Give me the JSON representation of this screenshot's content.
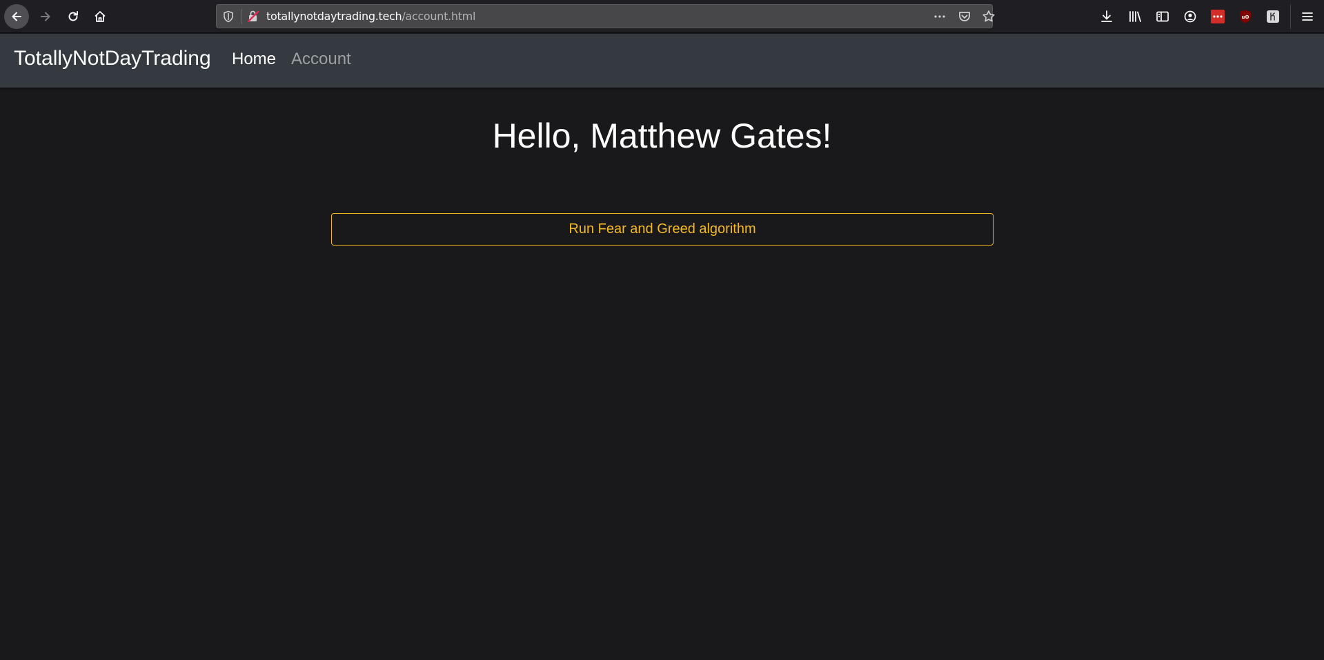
{
  "browser": {
    "url_host": "totallynotdaytrading.tech",
    "url_path": "/account.html",
    "icons": [
      "back-icon",
      "forward-icon",
      "reload-icon",
      "home-icon",
      "tracking-shield-icon",
      "insecure-lock-icon",
      "more-actions-icon",
      "pocket-icon",
      "bookmark-star-icon",
      "download-icon",
      "library-icon",
      "sidebar-icon",
      "account-icon",
      "lastpass-icon",
      "ublock-icon",
      "extension-icon",
      "menu-icon"
    ]
  },
  "navbar": {
    "brand": "TotallyNotDayTrading",
    "links": [
      {
        "label": "Home"
      },
      {
        "label": "Account"
      }
    ]
  },
  "main": {
    "greeting": "Hello, Matthew Gates!",
    "run_button_label": "Run Fear and Greed algorithm"
  },
  "colors": {
    "page_background": "#19181a",
    "navbar_background": "#343a40",
    "accent_warning": "#f5b921",
    "nav_active": "#ffffff",
    "nav_inactive": "#9da1a6"
  }
}
